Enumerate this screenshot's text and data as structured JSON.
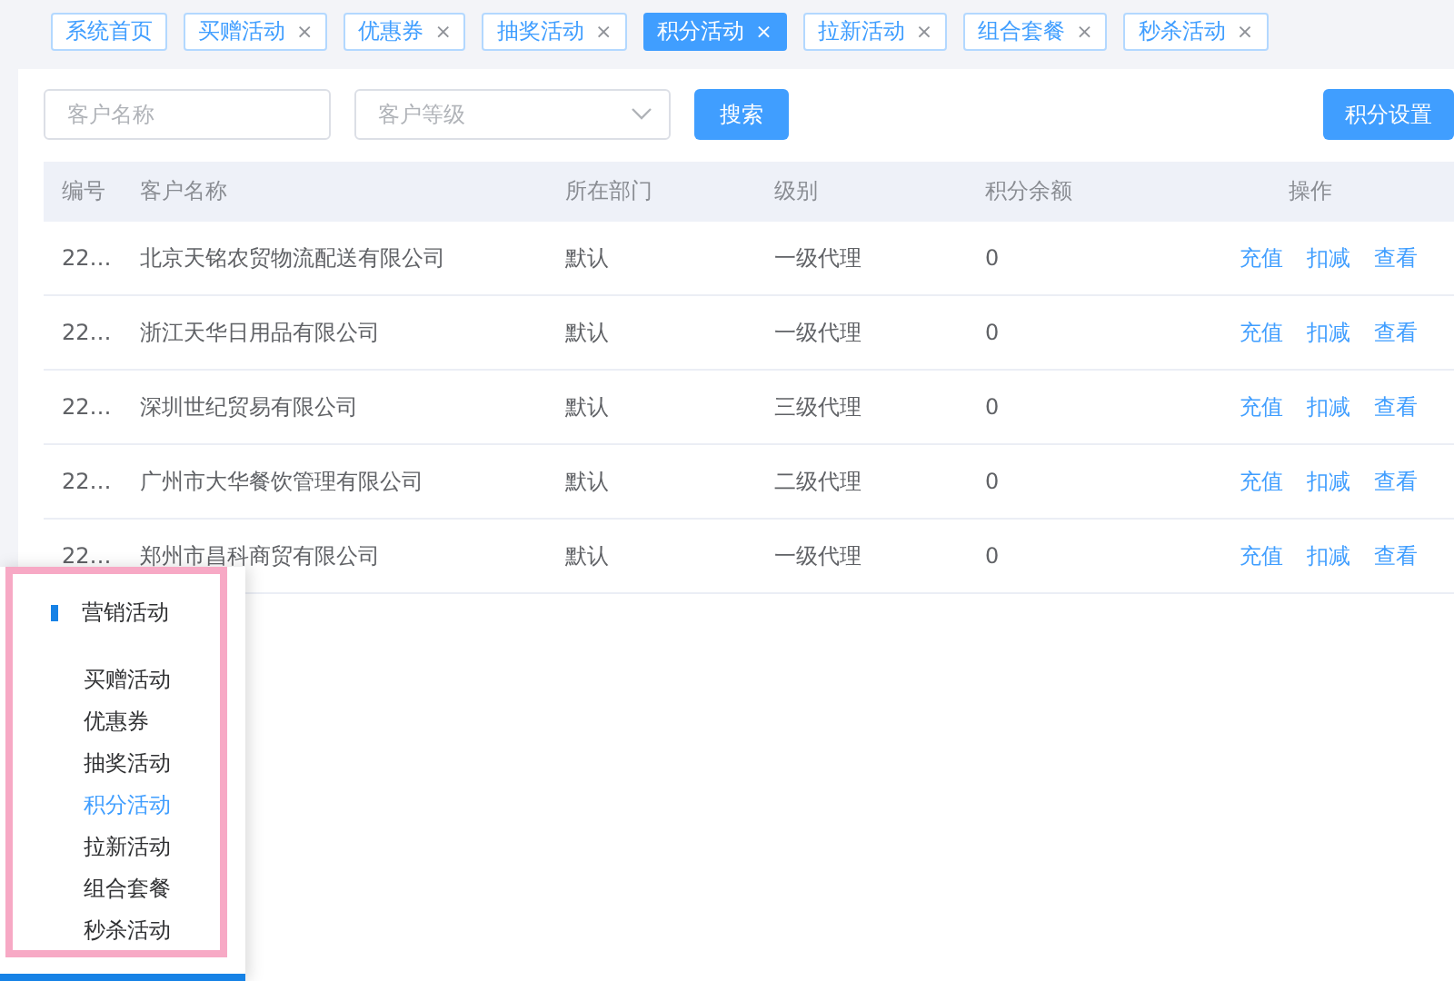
{
  "tabs": [
    {
      "label": "系统首页",
      "selected": false,
      "closable": false
    },
    {
      "label": "买赠活动",
      "selected": false,
      "closable": true
    },
    {
      "label": "优惠券",
      "selected": false,
      "closable": true
    },
    {
      "label": "抽奖活动",
      "selected": false,
      "closable": true
    },
    {
      "label": "积分活动",
      "selected": true,
      "closable": true
    },
    {
      "label": "拉新活动",
      "selected": false,
      "closable": true
    },
    {
      "label": "组合套餐",
      "selected": false,
      "closable": true
    },
    {
      "label": "秒杀活动",
      "selected": false,
      "closable": true
    }
  ],
  "close_glyph": "×",
  "filters": {
    "name": {
      "placeholder": "客户名称"
    },
    "level": {
      "placeholder": "客户等级"
    },
    "search_button": "搜索",
    "settings_button": "积分设置"
  },
  "table": {
    "columns": [
      "编号",
      "客户名称",
      "所在部门",
      "级别",
      "积分余额",
      "操作"
    ],
    "rows": [
      {
        "id": "22…",
        "name": "北京天铭农贸物流配送有限公司",
        "department": "默认",
        "level_name": "一级代理",
        "balance": "0",
        "actions": [
          "充值",
          "扣减",
          "查看"
        ]
      },
      {
        "id": "22…",
        "name": "浙江天华日用品有限公司",
        "department": "默认",
        "level_name": "一级代理",
        "balance": "0",
        "actions": [
          "充值",
          "扣减",
          "查看"
        ]
      },
      {
        "id": "22…",
        "name": "深圳世纪贸易有限公司",
        "department": "默认",
        "level_name": "三级代理",
        "balance": "0",
        "actions": [
          "充值",
          "扣减",
          "查看"
        ]
      },
      {
        "id": "22…",
        "name": "广州市大华餐饮管理有限公司",
        "department": "默认",
        "level_name": "二级代理",
        "balance": "0",
        "actions": [
          "充值",
          "扣减",
          "查看"
        ]
      },
      {
        "id": "22…",
        "name": "郑州市昌科商贸有限公司",
        "department": "默认",
        "level_name": "一级代理",
        "balance": "0",
        "actions": [
          "充值",
          "扣减",
          "查看"
        ]
      }
    ]
  },
  "popup_menu": {
    "title": "营销活动",
    "items": [
      {
        "label": "买赠活动",
        "selected": false
      },
      {
        "label": "优惠券",
        "selected": false
      },
      {
        "label": "抽奖活动",
        "selected": false
      },
      {
        "label": "积分活动",
        "selected": true
      },
      {
        "label": "拉新活动",
        "selected": false
      },
      {
        "label": "组合套餐",
        "selected": false
      },
      {
        "label": "秒杀活动",
        "selected": false
      }
    ]
  }
}
